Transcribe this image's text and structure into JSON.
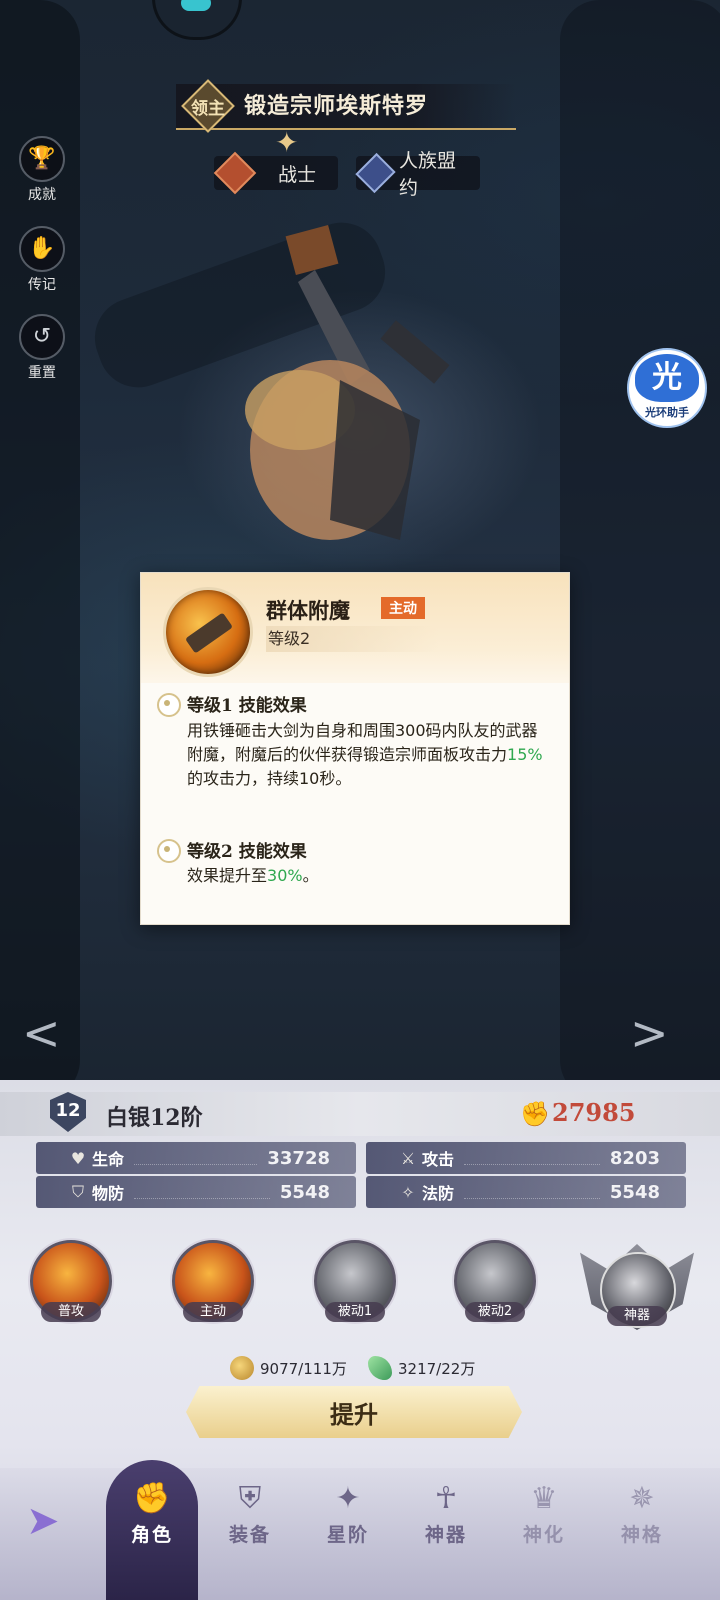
{
  "hero": {
    "lord_badge": "领主",
    "name": "锻造宗师埃斯特罗",
    "class_label": "战士",
    "faction_label": "人族盟约"
  },
  "side_buttons": [
    {
      "label": "成就",
      "icon": "trophy-icon"
    },
    {
      "label": "传记",
      "icon": "handshake-icon"
    },
    {
      "label": "重置",
      "icon": "reset-icon"
    }
  ],
  "floating_helper": {
    "glyph": "光",
    "label": "光环助手"
  },
  "skill_popup": {
    "name": "群体附魔",
    "type_badge": "主动",
    "level": "等级2",
    "sections": [
      {
        "title": "等级1 技能效果",
        "text_before": "用铁锤砸击大剑为自身和周围300码内队友的武器附魔，附魔后的伙伴获得锻造宗师面板攻击力",
        "highlight": "15%",
        "text_after": "的攻击力，持续10秒。"
      },
      {
        "title": "等级2 技能效果",
        "text_before": "效果提升至",
        "highlight": "30%",
        "text_after": "。"
      }
    ]
  },
  "rank": {
    "level": "12",
    "title": "白银12阶"
  },
  "power": "27985",
  "stats": {
    "hp": {
      "label": "生命",
      "value": "33728"
    },
    "atk": {
      "label": "攻击",
      "value": "8203"
    },
    "pdef": {
      "label": "物防",
      "value": "5548"
    },
    "mdef": {
      "label": "法防",
      "value": "5548"
    }
  },
  "skills": [
    {
      "label": "普攻",
      "style": "fire"
    },
    {
      "label": "主动",
      "style": "fire"
    },
    {
      "label": "被动1",
      "style": "gray"
    },
    {
      "label": "被动2",
      "style": "gray"
    },
    {
      "label": "神器",
      "style": "artifact"
    }
  ],
  "resources": {
    "gold": "9077/111万",
    "crystal": "3217/22万"
  },
  "upgrade_label": "提升",
  "nav": [
    {
      "label": "角色",
      "icon": "fist-icon",
      "active": true
    },
    {
      "label": "装备",
      "icon": "armor-icon",
      "active": false
    },
    {
      "label": "星阶",
      "icon": "star-icon",
      "active": false
    },
    {
      "label": "神器",
      "icon": "artifact-icon",
      "active": false
    },
    {
      "label": "神化",
      "icon": "crown-icon",
      "active": false
    },
    {
      "label": "神格",
      "icon": "divinity-icon",
      "active": false
    }
  ],
  "colors": {
    "highlight_green": "#2fa84f",
    "power_red": "#c24a3a",
    "active_badge": "#e46a2a"
  }
}
